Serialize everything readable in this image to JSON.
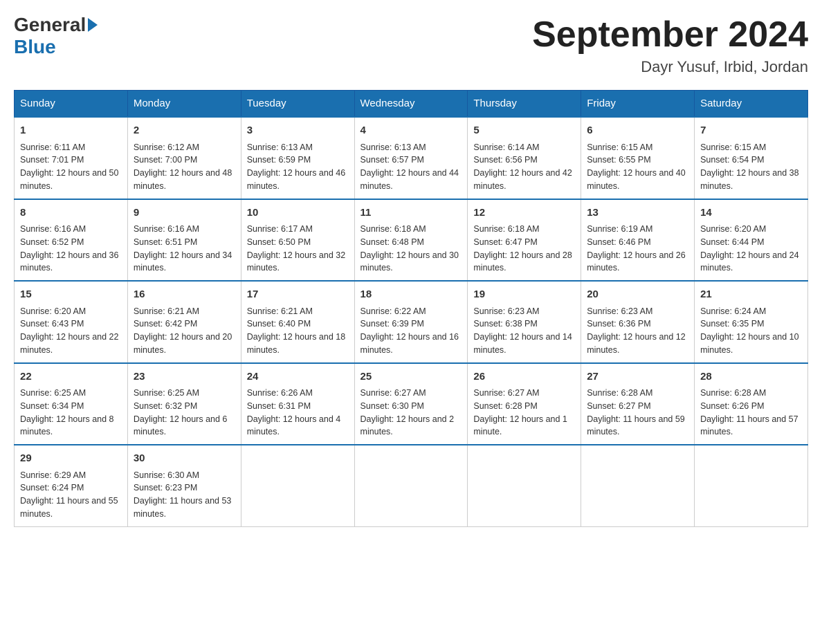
{
  "header": {
    "logo_general": "General",
    "logo_blue": "Blue",
    "month": "September 2024",
    "location": "Dayr Yusuf, Irbid, Jordan"
  },
  "days_of_week": [
    "Sunday",
    "Monday",
    "Tuesday",
    "Wednesday",
    "Thursday",
    "Friday",
    "Saturday"
  ],
  "weeks": [
    [
      {
        "day": "1",
        "sunrise": "Sunrise: 6:11 AM",
        "sunset": "Sunset: 7:01 PM",
        "daylight": "Daylight: 12 hours and 50 minutes."
      },
      {
        "day": "2",
        "sunrise": "Sunrise: 6:12 AM",
        "sunset": "Sunset: 7:00 PM",
        "daylight": "Daylight: 12 hours and 48 minutes."
      },
      {
        "day": "3",
        "sunrise": "Sunrise: 6:13 AM",
        "sunset": "Sunset: 6:59 PM",
        "daylight": "Daylight: 12 hours and 46 minutes."
      },
      {
        "day": "4",
        "sunrise": "Sunrise: 6:13 AM",
        "sunset": "Sunset: 6:57 PM",
        "daylight": "Daylight: 12 hours and 44 minutes."
      },
      {
        "day": "5",
        "sunrise": "Sunrise: 6:14 AM",
        "sunset": "Sunset: 6:56 PM",
        "daylight": "Daylight: 12 hours and 42 minutes."
      },
      {
        "day": "6",
        "sunrise": "Sunrise: 6:15 AM",
        "sunset": "Sunset: 6:55 PM",
        "daylight": "Daylight: 12 hours and 40 minutes."
      },
      {
        "day": "7",
        "sunrise": "Sunrise: 6:15 AM",
        "sunset": "Sunset: 6:54 PM",
        "daylight": "Daylight: 12 hours and 38 minutes."
      }
    ],
    [
      {
        "day": "8",
        "sunrise": "Sunrise: 6:16 AM",
        "sunset": "Sunset: 6:52 PM",
        "daylight": "Daylight: 12 hours and 36 minutes."
      },
      {
        "day": "9",
        "sunrise": "Sunrise: 6:16 AM",
        "sunset": "Sunset: 6:51 PM",
        "daylight": "Daylight: 12 hours and 34 minutes."
      },
      {
        "day": "10",
        "sunrise": "Sunrise: 6:17 AM",
        "sunset": "Sunset: 6:50 PM",
        "daylight": "Daylight: 12 hours and 32 minutes."
      },
      {
        "day": "11",
        "sunrise": "Sunrise: 6:18 AM",
        "sunset": "Sunset: 6:48 PM",
        "daylight": "Daylight: 12 hours and 30 minutes."
      },
      {
        "day": "12",
        "sunrise": "Sunrise: 6:18 AM",
        "sunset": "Sunset: 6:47 PM",
        "daylight": "Daylight: 12 hours and 28 minutes."
      },
      {
        "day": "13",
        "sunrise": "Sunrise: 6:19 AM",
        "sunset": "Sunset: 6:46 PM",
        "daylight": "Daylight: 12 hours and 26 minutes."
      },
      {
        "day": "14",
        "sunrise": "Sunrise: 6:20 AM",
        "sunset": "Sunset: 6:44 PM",
        "daylight": "Daylight: 12 hours and 24 minutes."
      }
    ],
    [
      {
        "day": "15",
        "sunrise": "Sunrise: 6:20 AM",
        "sunset": "Sunset: 6:43 PM",
        "daylight": "Daylight: 12 hours and 22 minutes."
      },
      {
        "day": "16",
        "sunrise": "Sunrise: 6:21 AM",
        "sunset": "Sunset: 6:42 PM",
        "daylight": "Daylight: 12 hours and 20 minutes."
      },
      {
        "day": "17",
        "sunrise": "Sunrise: 6:21 AM",
        "sunset": "Sunset: 6:40 PM",
        "daylight": "Daylight: 12 hours and 18 minutes."
      },
      {
        "day": "18",
        "sunrise": "Sunrise: 6:22 AM",
        "sunset": "Sunset: 6:39 PM",
        "daylight": "Daylight: 12 hours and 16 minutes."
      },
      {
        "day": "19",
        "sunrise": "Sunrise: 6:23 AM",
        "sunset": "Sunset: 6:38 PM",
        "daylight": "Daylight: 12 hours and 14 minutes."
      },
      {
        "day": "20",
        "sunrise": "Sunrise: 6:23 AM",
        "sunset": "Sunset: 6:36 PM",
        "daylight": "Daylight: 12 hours and 12 minutes."
      },
      {
        "day": "21",
        "sunrise": "Sunrise: 6:24 AM",
        "sunset": "Sunset: 6:35 PM",
        "daylight": "Daylight: 12 hours and 10 minutes."
      }
    ],
    [
      {
        "day": "22",
        "sunrise": "Sunrise: 6:25 AM",
        "sunset": "Sunset: 6:34 PM",
        "daylight": "Daylight: 12 hours and 8 minutes."
      },
      {
        "day": "23",
        "sunrise": "Sunrise: 6:25 AM",
        "sunset": "Sunset: 6:32 PM",
        "daylight": "Daylight: 12 hours and 6 minutes."
      },
      {
        "day": "24",
        "sunrise": "Sunrise: 6:26 AM",
        "sunset": "Sunset: 6:31 PM",
        "daylight": "Daylight: 12 hours and 4 minutes."
      },
      {
        "day": "25",
        "sunrise": "Sunrise: 6:27 AM",
        "sunset": "Sunset: 6:30 PM",
        "daylight": "Daylight: 12 hours and 2 minutes."
      },
      {
        "day": "26",
        "sunrise": "Sunrise: 6:27 AM",
        "sunset": "Sunset: 6:28 PM",
        "daylight": "Daylight: 12 hours and 1 minute."
      },
      {
        "day": "27",
        "sunrise": "Sunrise: 6:28 AM",
        "sunset": "Sunset: 6:27 PM",
        "daylight": "Daylight: 11 hours and 59 minutes."
      },
      {
        "day": "28",
        "sunrise": "Sunrise: 6:28 AM",
        "sunset": "Sunset: 6:26 PM",
        "daylight": "Daylight: 11 hours and 57 minutes."
      }
    ],
    [
      {
        "day": "29",
        "sunrise": "Sunrise: 6:29 AM",
        "sunset": "Sunset: 6:24 PM",
        "daylight": "Daylight: 11 hours and 55 minutes."
      },
      {
        "day": "30",
        "sunrise": "Sunrise: 6:30 AM",
        "sunset": "Sunset: 6:23 PM",
        "daylight": "Daylight: 11 hours and 53 minutes."
      },
      {
        "day": "",
        "sunrise": "",
        "sunset": "",
        "daylight": ""
      },
      {
        "day": "",
        "sunrise": "",
        "sunset": "",
        "daylight": ""
      },
      {
        "day": "",
        "sunrise": "",
        "sunset": "",
        "daylight": ""
      },
      {
        "day": "",
        "sunrise": "",
        "sunset": "",
        "daylight": ""
      },
      {
        "day": "",
        "sunrise": "",
        "sunset": "",
        "daylight": ""
      }
    ]
  ]
}
